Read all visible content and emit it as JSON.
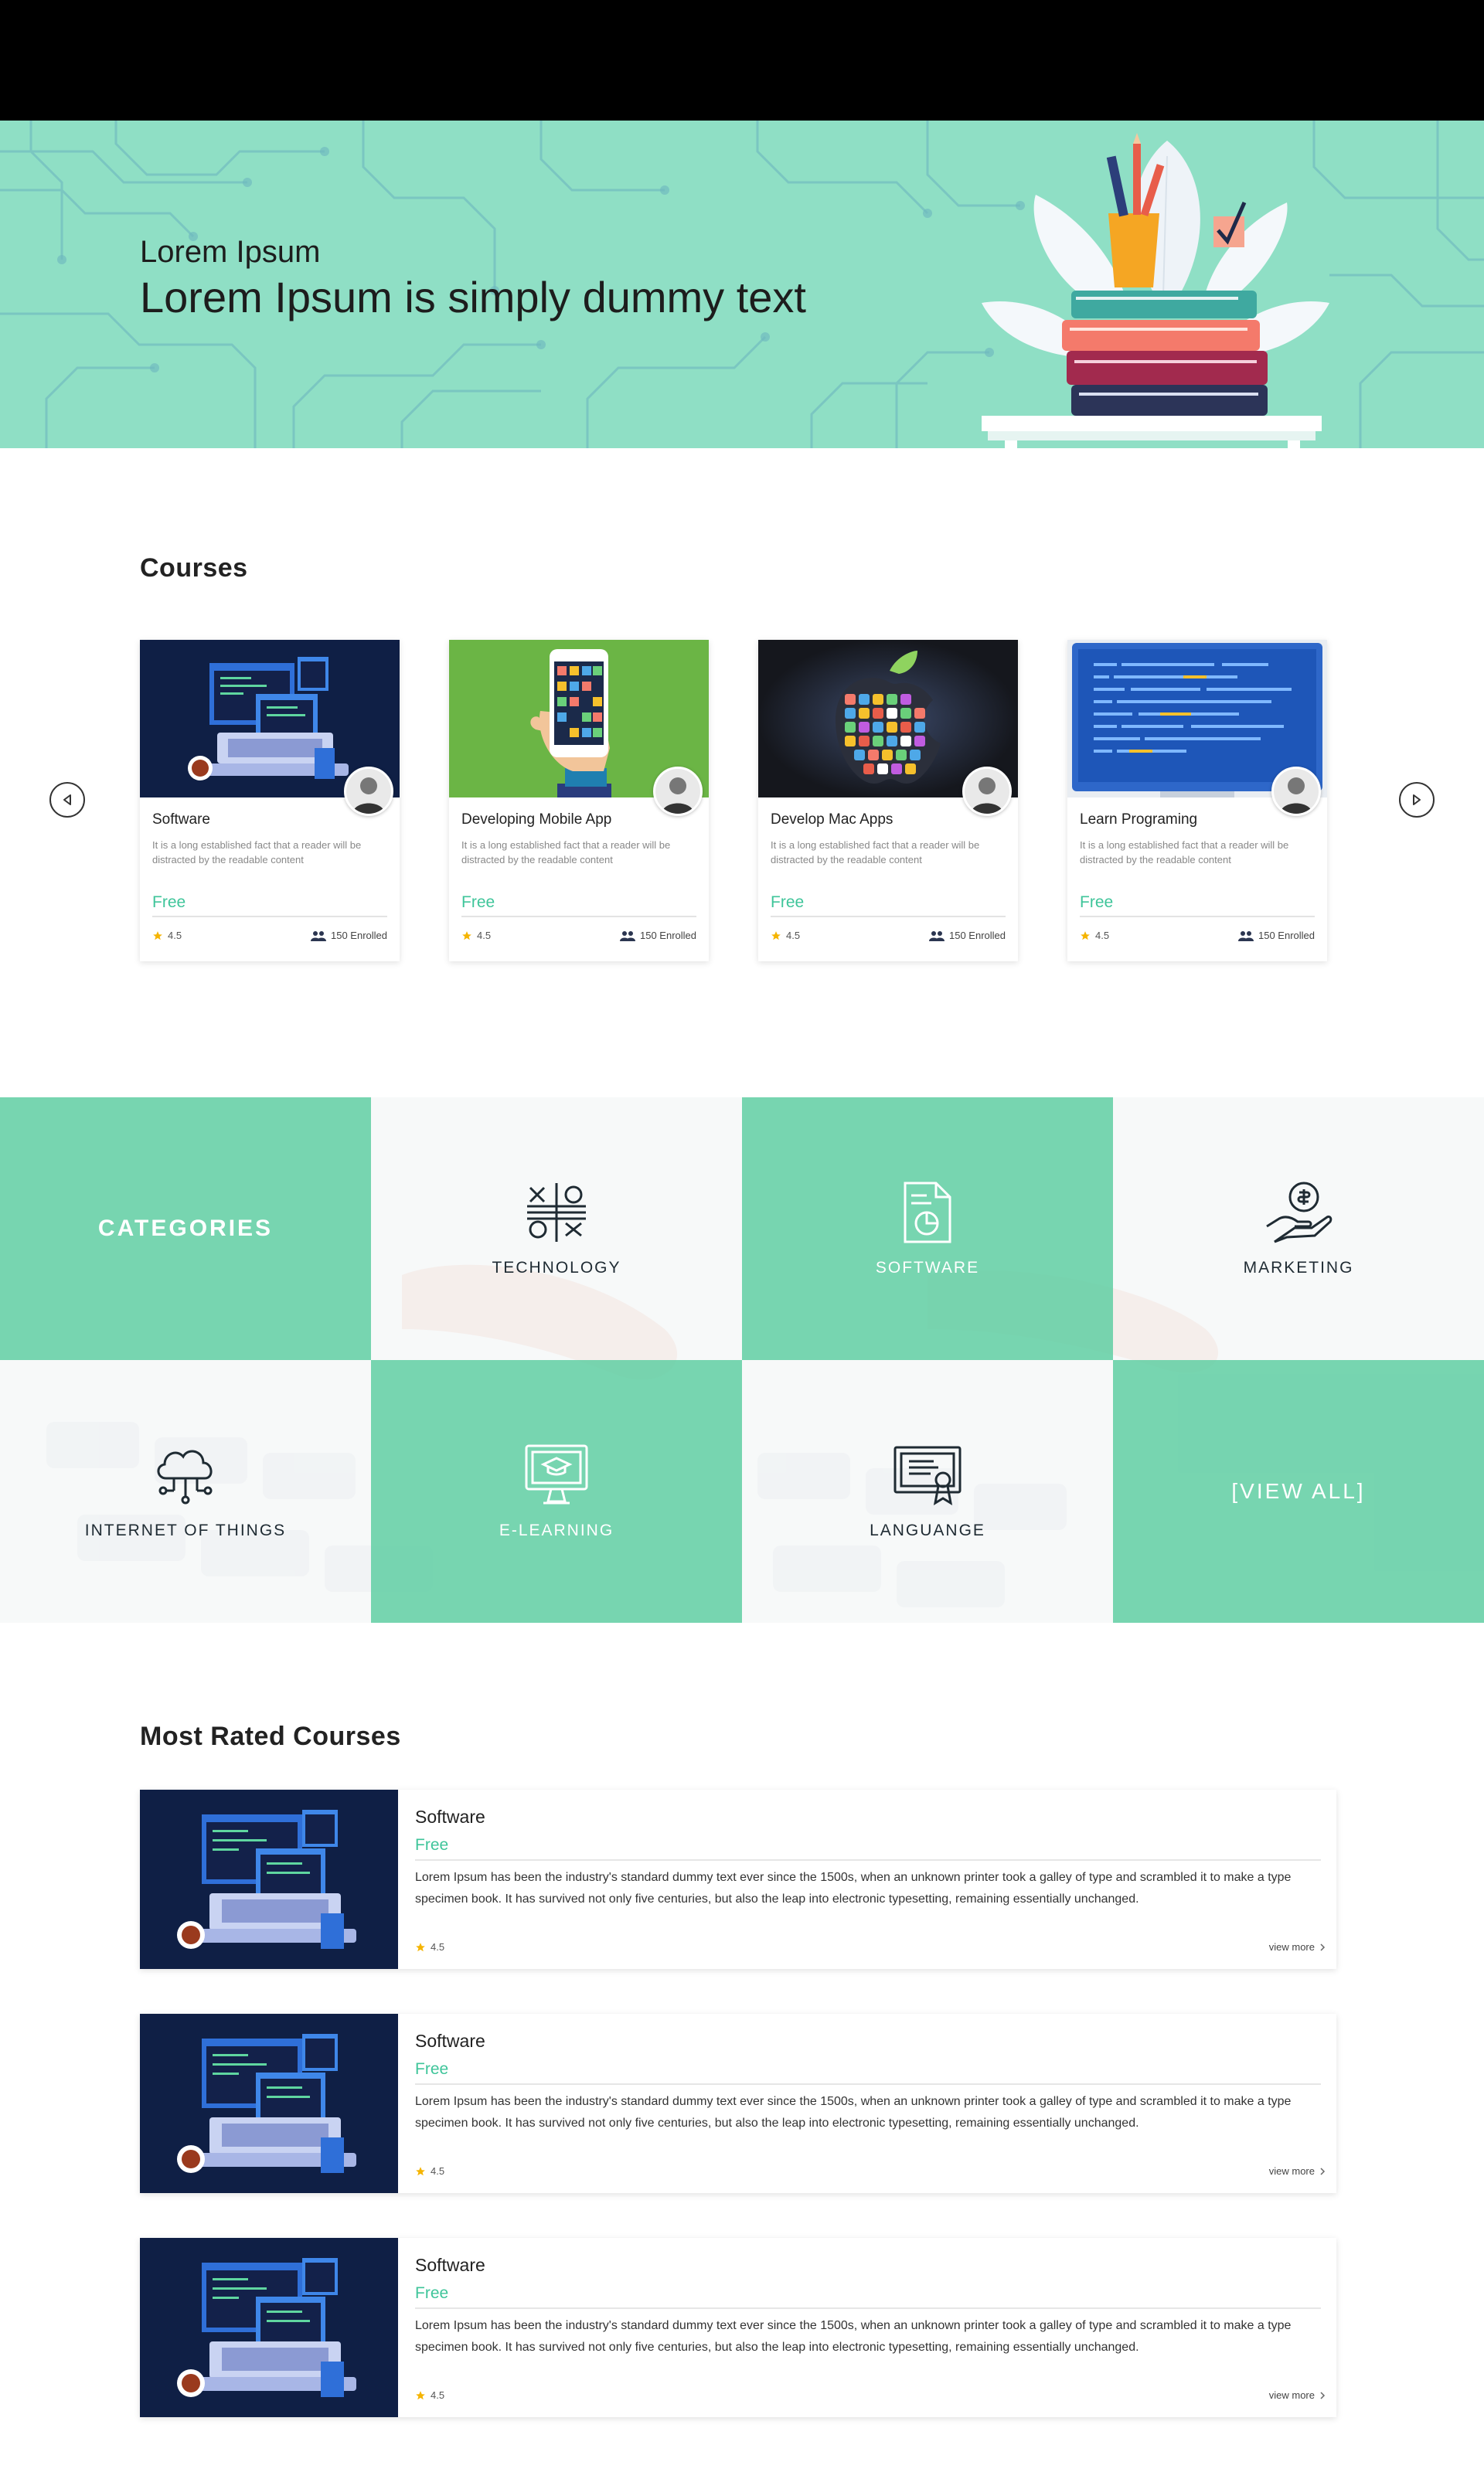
{
  "hero": {
    "subtitle": "Lorem Ipsum",
    "title": "Lorem Ipsum is simply dummy text"
  },
  "courses": {
    "heading": "Courses",
    "items": [
      {
        "title": "Software",
        "description": "It is a long established fact that a reader will be distracted by the readable content",
        "price": "Free",
        "rating": "4.5",
        "enrolled": "150 Enrolled"
      },
      {
        "title": "Developing Mobile App",
        "description": "It is a long established fact that a reader will be distracted by the readable content",
        "price": "Free",
        "rating": "4.5",
        "enrolled": "150 Enrolled"
      },
      {
        "title": "Develop Mac Apps",
        "description": "It is a long established fact that a reader will be distracted by the readable content",
        "price": "Free",
        "rating": "4.5",
        "enrolled": "150 Enrolled"
      },
      {
        "title": "Learn Programing",
        "description": "It is a long established fact that a reader will be distracted by the readable content",
        "price": "Free",
        "rating": "4.5",
        "enrolled": "150 Enrolled"
      }
    ]
  },
  "categories": {
    "heading": "CATEGORIES",
    "items": [
      {
        "label": "TECHNOLOGY",
        "icon": "technology-icon"
      },
      {
        "label": "SOFTWARE",
        "icon": "software-icon"
      },
      {
        "label": "MARKETING",
        "icon": "marketing-icon"
      },
      {
        "label": "INTERNET OF THINGS",
        "icon": "cloud-icon"
      },
      {
        "label": "E-LEARNING",
        "icon": "elearning-icon"
      },
      {
        "label": "LANGUANGE",
        "icon": "certificate-icon"
      }
    ],
    "view_all": "[VIEW ALL]"
  },
  "most_rated": {
    "heading": "Most Rated Courses",
    "items": [
      {
        "title": "Software",
        "price": "Free",
        "description": "Lorem Ipsum has been the industry's standard dummy  text ever since the 1500s, when an unknown printer took a galley of type and scrambled it to make a type specimen book. It has survived not only five centuries, but also the leap into electronic typesetting, remaining essentially unchanged.",
        "rating": "4.5",
        "more": "view more"
      },
      {
        "title": "Software",
        "price": "Free",
        "description": "Lorem Ipsum has been the industry's standard dummy  text ever since the 1500s, when an unknown printer took a galley of type and scrambled it to make a type specimen book. It has survived not only five centuries, but also the leap into electronic typesetting, remaining essentially unchanged.",
        "rating": "4.5",
        "more": "view more"
      },
      {
        "title": "Software",
        "price": "Free",
        "description": "Lorem Ipsum has been the industry's standard dummy  text ever since the 1500s, when an unknown printer took a galley of type and scrambled it to make a type specimen book. It has survived not only five centuries, but also the leap into electronic typesetting, remaining essentially unchanged.",
        "rating": "4.5",
        "more": "view more"
      }
    ]
  },
  "colors": {
    "hero_bg": "#8fdfc5",
    "accent": "#3fc59a",
    "tile_green": "#6cd2aa",
    "thumb_dark": "#0f1f45"
  }
}
